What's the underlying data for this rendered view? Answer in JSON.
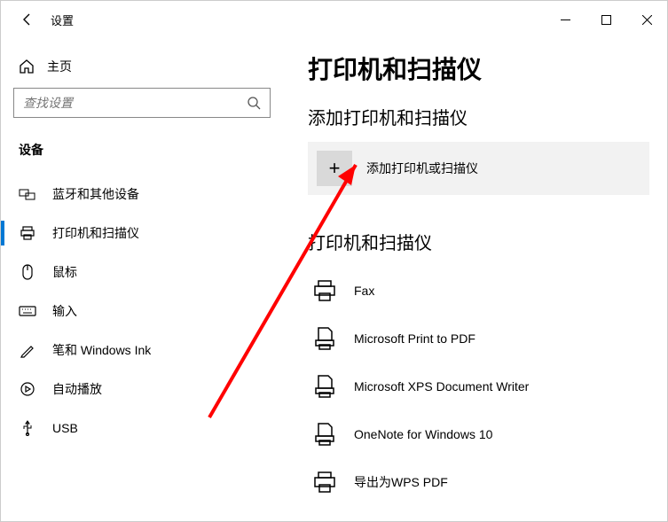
{
  "titlebar": {
    "app_name": "设置"
  },
  "sidebar": {
    "home_label": "主页",
    "search_placeholder": "查找设置",
    "section_label": "设备",
    "items": [
      {
        "label": "蓝牙和其他设备"
      },
      {
        "label": "打印机和扫描仪"
      },
      {
        "label": "鼠标"
      },
      {
        "label": "输入"
      },
      {
        "label": "笔和 Windows Ink"
      },
      {
        "label": "自动播放"
      },
      {
        "label": "USB"
      }
    ]
  },
  "main": {
    "page_title": "打印机和扫描仪",
    "add_section_title": "添加打印机和扫描仪",
    "add_button_label": "添加打印机或扫描仪",
    "list_section_title": "打印机和扫描仪",
    "printers": [
      {
        "label": "Fax"
      },
      {
        "label": "Microsoft Print to PDF"
      },
      {
        "label": "Microsoft XPS Document Writer"
      },
      {
        "label": "OneNote for Windows 10"
      },
      {
        "label": "导出为WPS PDF"
      }
    ]
  }
}
